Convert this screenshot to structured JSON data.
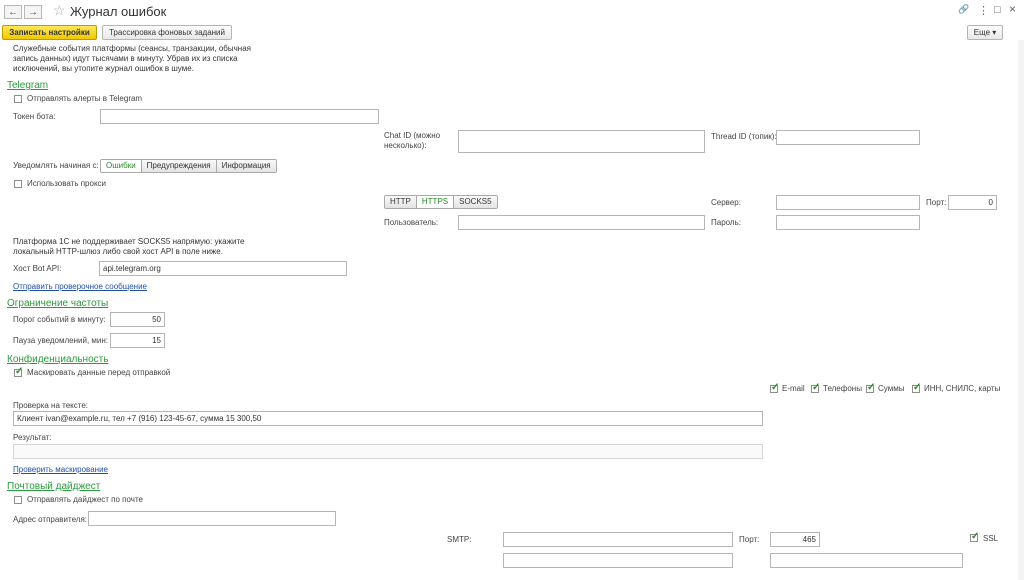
{
  "window": {
    "title": "Журнал ошибок",
    "back_icon": "←",
    "forward_icon": "→",
    "star_icon": "☆",
    "link_icon": "🔗",
    "menu_icon": "⋮",
    "max_icon": "□",
    "close_icon": "×"
  },
  "toolbar": {
    "save_label": "Записать настройки",
    "trace_label": "Трассировка фоновых заданий",
    "more_label": "Еще ▾"
  },
  "intro": "Служебные события платформы (сеансы, транзакции, обычная запись данных) идут тысячами в минуту. Убрав их из списка исключений, вы утопите журнал ошибок в шуме.",
  "telegram": {
    "heading": "Telegram",
    "send_alerts_label": "Отправлять алерты в Telegram",
    "send_alerts_checked": false,
    "token_label": "Токен бота:",
    "token_value": "",
    "chat_id_label": "Chat ID (можно несколько):",
    "chat_id_value": "",
    "thread_id_label": "Thread ID (топик):",
    "thread_id_value": "",
    "notify_from_label": "Уведомлять начиная с:",
    "levels": [
      "Ошибки",
      "Предупреждения",
      "Информация"
    ],
    "use_proxy_label": "Использовать прокси",
    "use_proxy_checked": false,
    "proxy_types": [
      "HTTP",
      "HTTPS",
      "SOCKS5"
    ],
    "server_label": "Сервер:",
    "server_value": "",
    "port_label": "Порт:",
    "port_value": "0",
    "user_label": "Пользователь:",
    "user_value": "",
    "password_label": "Пароль:",
    "password_value": "",
    "socks_note": "Платформа 1С не поддерживает SOCKS5 напрямую: укажите локальный HTTP-шлюз либо свой хост API в поле ниже.",
    "api_host_label": "Хост Bot API:",
    "api_host_value": "api.telegram.org",
    "test_link": "Отправить проверочное сообщение"
  },
  "rate": {
    "heading": "Ограничение частоты",
    "threshold_label": "Порог событий в минуту:",
    "threshold_value": "50",
    "pause_label": "Пауза уведомлений, мин:",
    "pause_value": "15"
  },
  "privacy": {
    "heading": "Конфиденциальность",
    "mask_label": "Маскировать данные перед отправкой",
    "mask_checked": true,
    "options": [
      {
        "label": "E-mail",
        "checked": true
      },
      {
        "label": "Телефоны",
        "checked": true
      },
      {
        "label": "Суммы",
        "checked": true
      },
      {
        "label": "ИНН, СНИЛС, карты",
        "checked": true
      }
    ],
    "check_text_label": "Проверка на тексте:",
    "check_text_value": "Клиент ivan@example.ru, тел +7 (916) 123-45-67, сумма 15 300,50",
    "result_label": "Результат:",
    "result_value": "",
    "check_link": "Проверить маскирование"
  },
  "mail": {
    "heading": "Почтовый дайджест",
    "send_digest_label": "Отправлять дайджест по почте",
    "send_digest_checked": false,
    "sender_label": "Адрес отправителя:",
    "sender_value": "",
    "smtp_label": "SMTP:",
    "smtp_value": "",
    "port_label": "Порт:",
    "port_value": "465",
    "ssl_label": "SSL",
    "ssl_checked": true
  }
}
